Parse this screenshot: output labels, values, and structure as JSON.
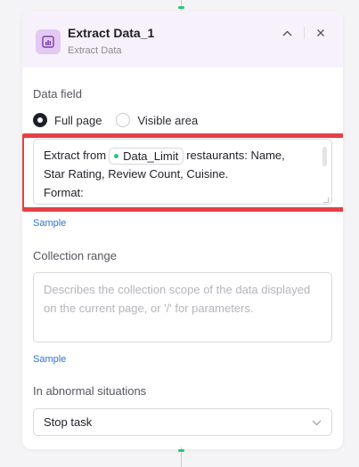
{
  "node": {
    "title": "Extract Data_1",
    "subtitle": "Extract Data",
    "icon": "chart-icon",
    "accent_color": "#e3c9f3"
  },
  "header_buttons": {
    "collapse_icon": "chevron-up-icon",
    "close_icon": "close-icon",
    "collapse_glyph": "⌃",
    "close_glyph": "✕"
  },
  "data_field": {
    "label": "Data field",
    "options": [
      {
        "label": "Full page",
        "checked": true
      },
      {
        "label": "Visible area",
        "checked": false
      }
    ]
  },
  "prompt": {
    "prefix": "Extract from",
    "variable": "Data_Limit",
    "line1_suffix": "restaurants: Name,",
    "line2": "Star Rating, Review Count, Cuisine.",
    "line3": "Format:"
  },
  "sample_link_1": "Sample",
  "collection_range": {
    "label": "Collection range",
    "placeholder": "Describes the collection scope of the data displayed on the current page, or '/' for parameters."
  },
  "sample_link_2": "Sample",
  "abnormal": {
    "label": "In abnormal situations",
    "selected": "Stop task"
  },
  "colors": {
    "highlight": "#e54045",
    "connector": "#2fc27a",
    "link": "#2b73d9"
  }
}
